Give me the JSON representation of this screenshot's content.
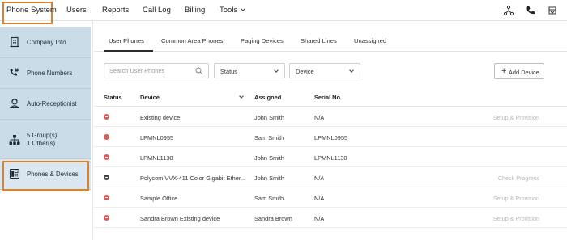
{
  "topnav": {
    "items": [
      {
        "label": "Phone System",
        "active": true
      },
      {
        "label": "Users"
      },
      {
        "label": "Reports"
      },
      {
        "label": "Call Log"
      },
      {
        "label": "Billing"
      },
      {
        "label": "Tools"
      }
    ],
    "icons": [
      "network-icon",
      "phone-icon",
      "notifications-icon"
    ],
    "active_outline_color": "#d9822b"
  },
  "sidebar": {
    "background_color": "#c9dce8",
    "items": [
      {
        "label": "Company Info",
        "icon": "building-icon"
      },
      {
        "label": "Phone Numbers",
        "icon": "phone-numbers-icon"
      },
      {
        "label": "Auto-Receptionist",
        "icon": "receptionist-icon"
      },
      {
        "label": "5 Group(s)",
        "label2": "1 Other(s)",
        "icon": "hierarchy-icon"
      },
      {
        "label": "Phones & Devices",
        "icon": "desk-phone-icon",
        "active": true
      }
    ]
  },
  "tabs": [
    {
      "label": "User Phones",
      "active": true
    },
    {
      "label": "Common Area Phones"
    },
    {
      "label": "Paging Devices"
    },
    {
      "label": "Shared Lines"
    },
    {
      "label": "Unassigned"
    }
  ],
  "toolbar": {
    "search_placeholder": "Search User Phones",
    "status_select": "Status",
    "device_select": "Device",
    "add_button": "Add Device"
  },
  "table": {
    "headers": [
      "Status",
      "Device",
      "Assigned",
      "Serial No."
    ],
    "rows": [
      {
        "status": "error",
        "device": "Existing device",
        "assigned": "John Smith",
        "serial": "N/A",
        "action": "Setup & Provision"
      },
      {
        "status": "error",
        "device": "LPMNL0955",
        "assigned": "Sam Smith",
        "serial": "LPMNL0955",
        "action": ""
      },
      {
        "status": "error",
        "device": "LPMNL1130",
        "assigned": "John Smith",
        "serial": "LPMNL1130",
        "action": ""
      },
      {
        "status": "ok",
        "device": "Polycom VVX-411 Color Gigabit Ether...",
        "assigned": "John Smith",
        "serial": "N/A",
        "action": "Check Progress"
      },
      {
        "status": "error",
        "device": "Sample Office",
        "assigned": "Sam Smith",
        "serial": "N/A",
        "action": "Setup & Provision"
      },
      {
        "status": "error",
        "device": "Sandra Brown Existing device",
        "assigned": "Sandra Brown",
        "serial": "N/A",
        "action": "Setup & Provision"
      }
    ]
  },
  "colors": {
    "error_status": "#e05757",
    "ok_status": "#444444",
    "disabled_action": "#b9b9b9"
  }
}
